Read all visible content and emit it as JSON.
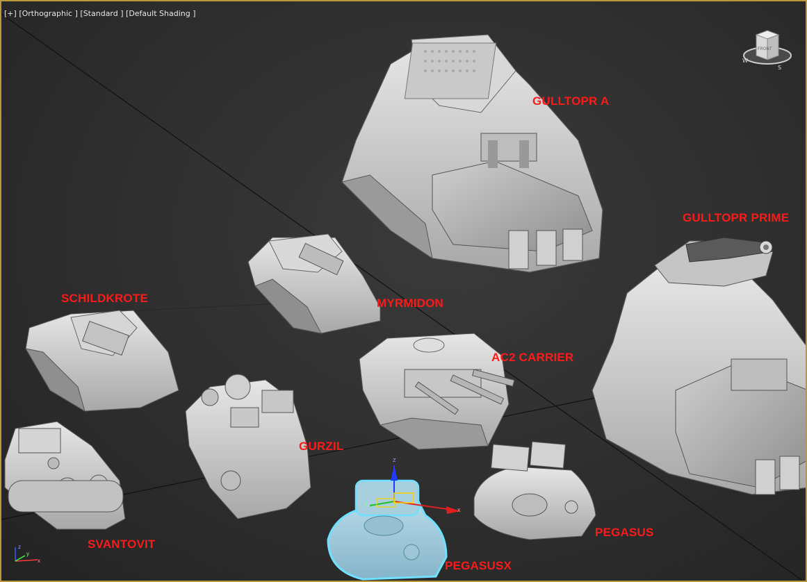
{
  "viewport": {
    "labels": {
      "plus": "[+]",
      "view": "[Orthographic ]",
      "mode": "[Standard ]",
      "shading": "[Default Shading ]"
    },
    "accent_border": "#b89a3c",
    "label_color": "#ff1a1a",
    "selection_color": "#6fe0ff"
  },
  "viewcube": {
    "face_label": "FRONT",
    "compass": [
      "W",
      "S"
    ]
  },
  "units": {
    "gulltopr_a": "GULLTOPR A",
    "gulltopr_prime": "GULLTOPR PRIME",
    "schildkrote": "SCHILDKROTE",
    "myrmidon": "MYRMIDON",
    "ac2_carrier": "AC2 CARRIER",
    "gurzil": "GURZIL",
    "svantovit": "SVANTOVIT",
    "pegasus": "PEGASUS",
    "pegasusx": "PEGASUSX"
  },
  "gizmo": {
    "z": "z",
    "x": "x",
    "y": "y"
  },
  "axis_tripod": {
    "z": "z",
    "x": "x",
    "y": "y"
  }
}
